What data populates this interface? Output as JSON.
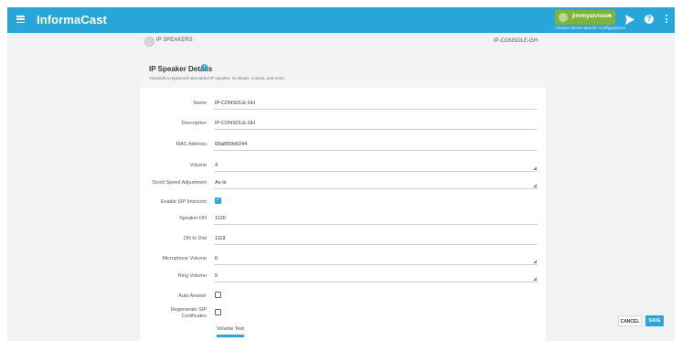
{
  "app": {
    "title": "InformaCast"
  },
  "user": {
    "name": "jimmyalvision",
    "caret": "▾",
    "device_note": "* Device Server-specific Configurations"
  },
  "breadcrumb": {
    "section": "IP SPEAKERS",
    "current": "IP-CONSOLE-GH"
  },
  "card": {
    "title": "IP Speaker Details",
    "subtitle": "View/edit a registered and added IP speaker, its details, volume, and more."
  },
  "fields": {
    "name": {
      "label": "Name",
      "value": "IP-CONSOLE-GH"
    },
    "description": {
      "label": "Description",
      "value": "IP-CONSOLE-GH"
    },
    "mac": {
      "label": "MAC Address",
      "value": "00a855fd9244"
    },
    "volume": {
      "label": "Volume",
      "value": "4"
    },
    "scroll_speed": {
      "label": "Scroll Speed Adjustment",
      "value": "As-Is"
    },
    "sip_intercom": {
      "label": "Enable SIP Intercom",
      "checked": true
    },
    "speaker_dn": {
      "label": "Speaker DN",
      "value": "1120"
    },
    "dn_to_dial": {
      "label": "DN to Dial",
      "value": "1118"
    },
    "mic_volume": {
      "label": "Microphone Volume",
      "value": "6"
    },
    "ring_volume": {
      "label": "Ring Volume",
      "value": "5"
    },
    "auto_answer": {
      "label": "Auto Answer",
      "checked": false
    },
    "regen_sip": {
      "label_line1": "Regenerate SIP",
      "label_line2": "Certificates",
      "checked": false
    }
  },
  "volume_test": {
    "label": "Volume Test"
  },
  "buttons": {
    "cancel": "CANCEL",
    "save": "SAVE"
  },
  "colors": {
    "accent": "#29a6d9",
    "user_chip": "#7db23d",
    "background": "#f1f2f3"
  }
}
